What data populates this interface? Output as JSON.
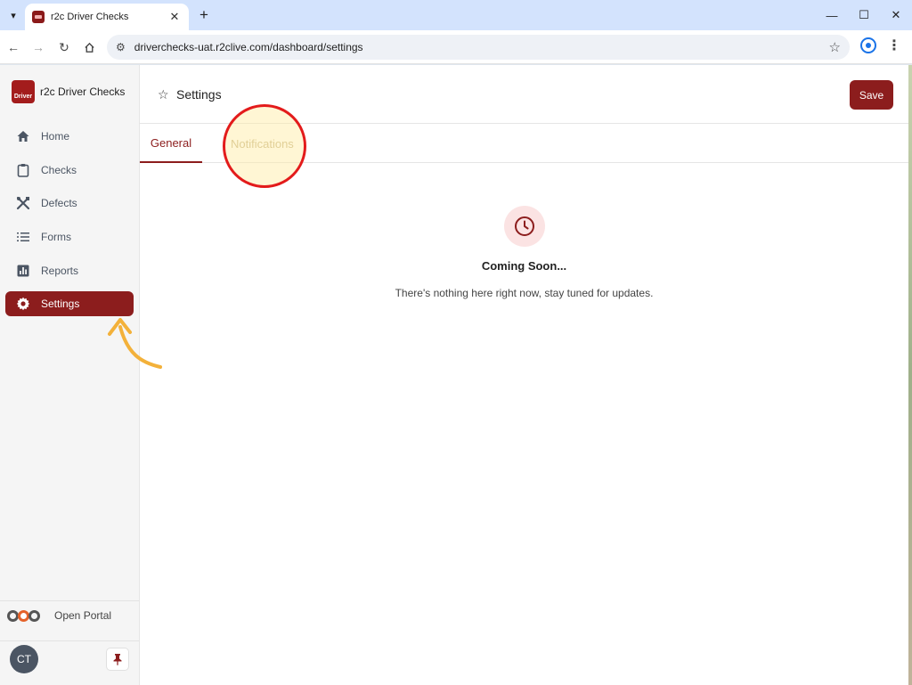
{
  "browser": {
    "tab_title": "r2c Driver Checks",
    "url": "driverchecks-uat.r2clive.com/dashboard/settings",
    "window_controls": [
      "minimize",
      "maximize",
      "close"
    ]
  },
  "sidebar": {
    "brand_name": "r2c Driver Checks",
    "brand_logo_text": "Driver",
    "items": [
      {
        "label": "Home",
        "icon": "home-icon"
      },
      {
        "label": "Checks",
        "icon": "clipboard-icon"
      },
      {
        "label": "Defects",
        "icon": "tools-icon"
      },
      {
        "label": "Forms",
        "icon": "list-icon"
      },
      {
        "label": "Reports",
        "icon": "bar-chart-icon"
      },
      {
        "label": "Settings",
        "icon": "gear-icon",
        "active": true
      }
    ],
    "portal_label": "Open Portal",
    "avatar_initials": "CT"
  },
  "header": {
    "title": "Settings",
    "save_label": "Save"
  },
  "tabs": [
    {
      "label": "General",
      "active": true
    },
    {
      "label": "Notifications",
      "active": false
    }
  ],
  "empty_state": {
    "title": "Coming Soon...",
    "subtitle": "There's nothing here right now, stay tuned for updates."
  },
  "colors": {
    "accent": "#8c1d1d",
    "highlight_ring": "#e31b1b"
  }
}
